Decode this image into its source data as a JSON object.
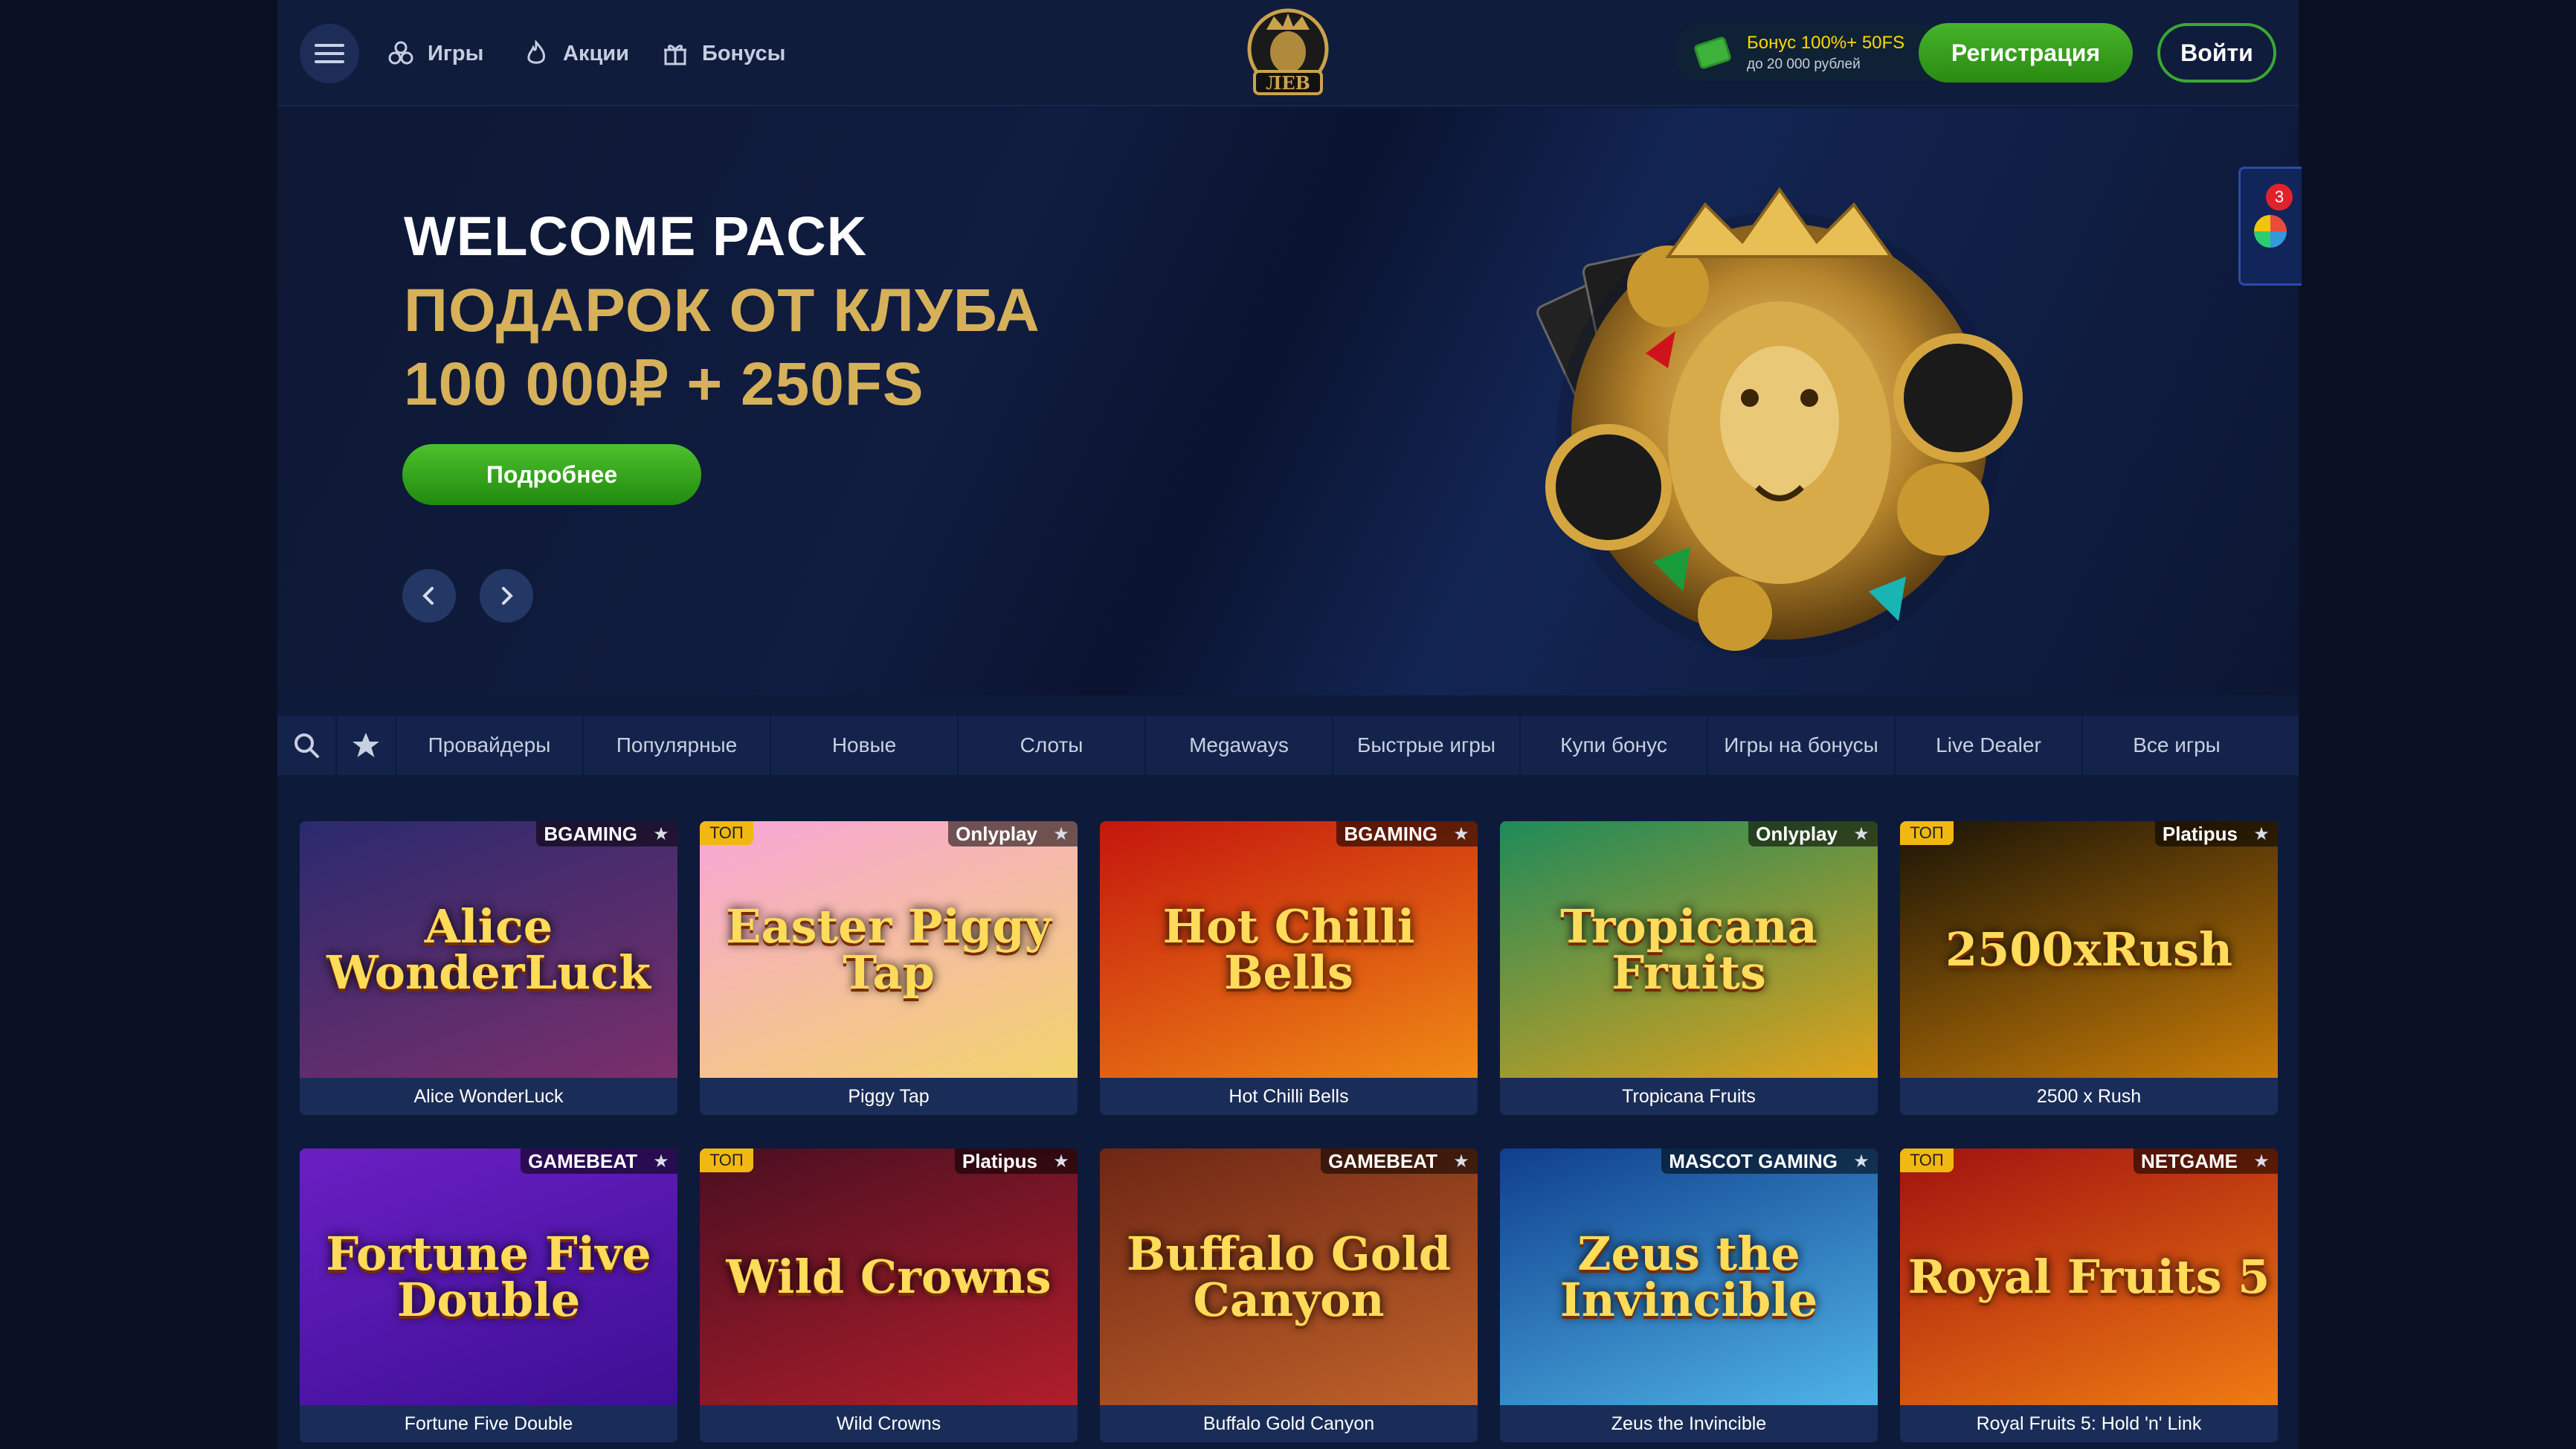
{
  "header": {
    "nav": [
      "Игры",
      "Акции",
      "Бонусы"
    ],
    "logo_text": "ЛЕВ",
    "bonus_line1": "Бонус 100%+ 50FS",
    "bonus_line2": "до 20 000 рублей",
    "register": "Регистрация",
    "login": "Войти"
  },
  "hero": {
    "title": "WELCOME PACK",
    "line2": "ПОДАРОК ОТ КЛУБА",
    "line3": "100 000₽ + 250FS",
    "button": "Подробнее",
    "side_badge": "3",
    "slide_progress": 0.5
  },
  "categories": [
    "Провайдеры",
    "Популярные",
    "Новые",
    "Слоты",
    "Megaways",
    "Быстрые игры",
    "Купи бонус",
    "Игры на бонусы",
    "Live Dealer",
    "Все игры"
  ],
  "games": [
    {
      "name": "Alice WonderLuck",
      "provider": "BGAMING",
      "top": false,
      "art": "Alice WonderLuck",
      "bg": "#2b2a6e",
      "bg2": "#7a2f6b"
    },
    {
      "name": "Piggy Tap",
      "provider": "Onlyplay",
      "top": true,
      "art": "Easter Piggy Tap",
      "bg": "#f7a6d8",
      "bg2": "#f2d36b"
    },
    {
      "name": "Hot Chilli Bells",
      "provider": "BGAMING",
      "top": false,
      "art": "Hot Chilli Bells",
      "bg": "#c4160d",
      "bg2": "#f08a15"
    },
    {
      "name": "Tropicana Fruits",
      "provider": "Onlyplay",
      "top": false,
      "art": "Tropicana Fruits",
      "bg": "#1f8a5a",
      "bg2": "#e0a21b"
    },
    {
      "name": "2500 x Rush",
      "provider": "Platipus",
      "top": true,
      "art": "2500xRush",
      "bg": "#1a1406",
      "bg2": "#c77b07"
    },
    {
      "name": "Fortune Five Double",
      "provider": "GAMEBEAT",
      "top": false,
      "art": "Fortune Five Double",
      "bg": "#6b1fc4",
      "bg2": "#3c0f93"
    },
    {
      "name": "Wild Crowns",
      "provider": "Platipus",
      "top": true,
      "art": "Wild Crowns",
      "bg": "#4a0f22",
      "bg2": "#b01e2a"
    },
    {
      "name": "Buffalo Gold Canyon",
      "provider": "GAMEBEAT",
      "top": false,
      "art": "Buffalo Gold Canyon",
      "bg": "#6e2614",
      "bg2": "#c1632a"
    },
    {
      "name": "Zeus the Invincible",
      "provider": "MASCOT GAMING",
      "top": false,
      "art": "Zeus the Invincible",
      "bg": "#0f3f8c",
      "bg2": "#4fb3e8"
    },
    {
      "name": "Royal Fruits 5: Hold 'n' Link",
      "provider": "NETGAME",
      "top": true,
      "art": "Royal Fruits 5",
      "bg": "#a0120f",
      "bg2": "#f07b12"
    }
  ],
  "labels": {
    "top_badge": "ТОП",
    "star": "★"
  },
  "colors": {
    "gold": "#d6b15a",
    "green": "#3aa832",
    "bg": "#0d1a3a"
  }
}
